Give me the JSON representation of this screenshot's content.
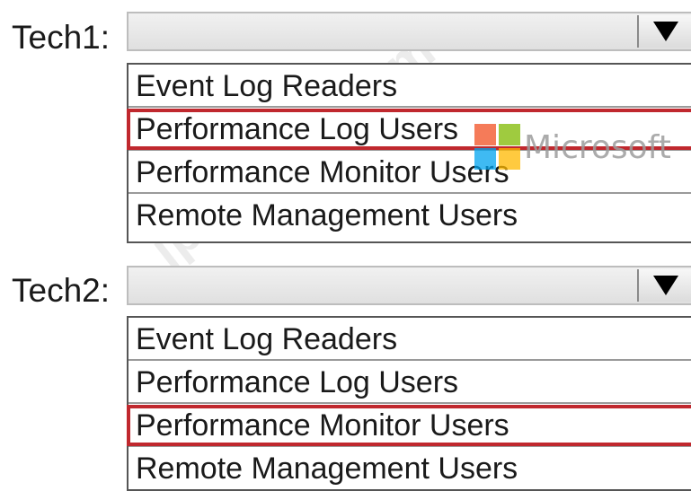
{
  "questions": [
    {
      "label": "Tech1:",
      "selected_value": "",
      "options": [
        "Event Log Readers",
        "Performance Log Users",
        "Performance Monitor Users",
        "Remote Management Users"
      ]
    },
    {
      "label": "Tech2:",
      "selected_value": "",
      "options": [
        "Event Log Readers",
        "Performance Log Users",
        "Performance Monitor Users",
        "Remote Management Users"
      ]
    }
  ],
  "highlight": {
    "tech1_selected_option": "Performance Log Users",
    "tech2_selected_option": "Performance Monitor Users",
    "color": "#c0282e"
  },
  "watermark": {
    "brand_text": "Microsoft",
    "diagonal_text": "jpshiken.com",
    "logo_colors": [
      "#f25022",
      "#7fba00",
      "#00a4ef",
      "#ffb900"
    ]
  }
}
